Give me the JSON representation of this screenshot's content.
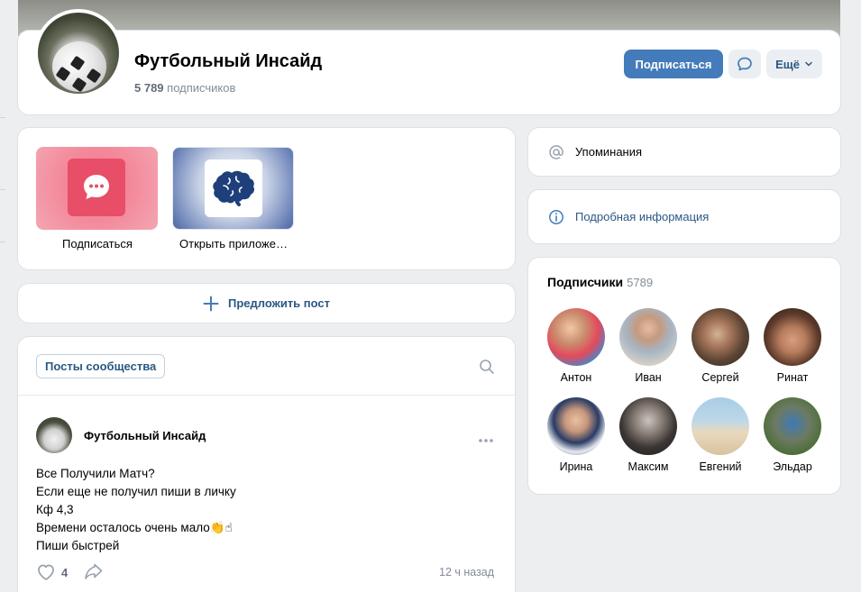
{
  "group": {
    "name": "Футбольный Инсайд",
    "subs_count": "5 789",
    "subs_label": "подписчиков",
    "subscribe_label": "Подписаться",
    "more_label": "Ещё"
  },
  "apps": [
    {
      "label": "Подписаться"
    },
    {
      "label": "Открыть приложе…"
    }
  ],
  "suggest": {
    "label": "Предложить пост"
  },
  "posts": {
    "tab_label": "Посты сообщества",
    "post": {
      "author": "Футбольный Инсайд",
      "lines": [
        "Все Получили Матч?",
        "Если еще не получил пиши в личку",
        "Кф 4,3",
        "Времени осталось очень мало👏☝",
        "Пиши быстрей"
      ],
      "likes": "4",
      "time": "12 ч назад"
    }
  },
  "sidebar": {
    "mentions_label": "Упоминания",
    "info_label": "Подробная информация",
    "subscribers_title": "Подписчики",
    "subscribers_count": "5789",
    "subscribers": [
      {
        "name": "Антон"
      },
      {
        "name": "Иван"
      },
      {
        "name": "Сергей"
      },
      {
        "name": "Ринат"
      },
      {
        "name": "Ирина"
      },
      {
        "name": "Максим"
      },
      {
        "name": "Евгений"
      },
      {
        "name": "Эльдар"
      }
    ]
  },
  "colors": {
    "accent": "#447bba",
    "link": "#2a5885",
    "background": "#edeef0"
  }
}
